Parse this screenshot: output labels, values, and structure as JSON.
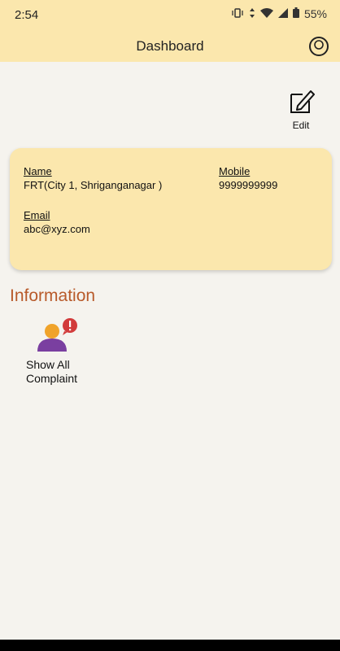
{
  "status_bar": {
    "time": "2:54",
    "battery": "55%"
  },
  "app_bar": {
    "title": "Dashboard"
  },
  "edit": {
    "label": "Edit"
  },
  "profile": {
    "name_label": "Name",
    "name_value": "FRT(City 1, Shriganganagar )",
    "mobile_label": "Mobile",
    "mobile_value": "9999999999",
    "email_label": "Email",
    "email_value": "abc@xyz.com"
  },
  "information": {
    "title": "Information",
    "items": [
      {
        "label_line1": "Show All",
        "label_line2": "Complaint",
        "icon": "complaint-user-icon"
      }
    ]
  },
  "colors": {
    "header_bg": "#fbe7ad",
    "page_bg": "#f5f3ee",
    "section_title": "#b85a2a",
    "alert_red": "#d23b3b",
    "person_purple": "#7a3fa0",
    "person_head_orange": "#f0a32a"
  }
}
